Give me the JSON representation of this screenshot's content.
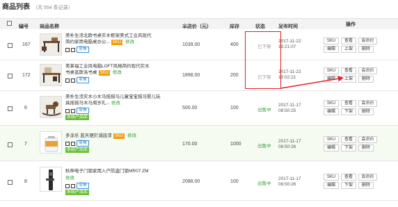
{
  "page": {
    "title": "商品列表",
    "count_text": "（共 554 条记录）"
  },
  "columns": {
    "no": "编号",
    "name": "商品名称",
    "price": "本店价（元）",
    "stock": "库存",
    "status": "状态",
    "time": "发布时间",
    "ops": "操作",
    "sort_mark": "▲▼"
  },
  "rows": [
    {
      "id": "167",
      "name_line1": "美朴生活北欧书桌实木框架美式工业风现代",
      "name_line2": "简约家用电脑桌办公...",
      "sku_tag": "SKU",
      "edit_label": "修改",
      "category_tag": "零售",
      "price": "1039.00",
      "stock": "400",
      "status": "已下架",
      "date": "2017-11-22",
      "time": "15:21:07",
      "buttons": [
        "SKU",
        "查看",
        "会员价",
        "编辑",
        "上架",
        "删除"
      ]
    },
    {
      "id": "172",
      "name_line1": "美莱福工业风电脑LOFT风格简约现代实木",
      "name_line2": "书桌蓝斯洛书桌",
      "sku_tag": "SKU",
      "edit_label": "修改",
      "category_tag": "零售",
      "price": "1898.00",
      "stock": "200",
      "status": "已下架",
      "date": "2017-11-22",
      "time": "15:02:21",
      "buttons": [
        "SKU",
        "查看",
        "会员价",
        "编辑",
        "上架",
        "删除"
      ]
    },
    {
      "id": "6",
      "name_line1": "美朴生活实木小木马摇摇马儿童宝宝摇马婴儿玩",
      "name_line2": "具摇摇马木马周岁礼...",
      "edit_label": "修改",
      "category_tag": "零售",
      "system_tag": "系统产品库",
      "price": "500.00",
      "stock": "100",
      "status": "出售中",
      "date": "2017-11-17",
      "time": "08:50:25",
      "buttons": [
        "SKU",
        "查看",
        "会员价",
        "编辑",
        "下架",
        "删除"
      ]
    },
    {
      "id": "7",
      "name_line1": "多涂乐 蓝天便於減底漆",
      "sku_tag": "SKU",
      "edit_label": "修改",
      "category_tag": "零售",
      "system_tag": "系统产品库",
      "price": "170.00",
      "stock": "1000",
      "status": "出售中",
      "date": "2017-11-17",
      "time": "08:50:26",
      "buttons": [
        "SKU",
        "查看",
        "会员价",
        "编辑",
        "下架",
        "删除"
      ]
    },
    {
      "id": "8",
      "name_line1": "秋神电子门锁家用入户防盗门锁MR07 ZM",
      "edit_label": "修改",
      "category_tag": "零售",
      "system_tag": "系统产品库",
      "price": "2088.00",
      "stock": "100",
      "status": "出售中",
      "date": "2017-11-17",
      "time": "08:50:26",
      "buttons": [
        "SKU",
        "查看",
        "会员价",
        "编辑",
        "下架",
        "删除"
      ]
    }
  ],
  "colors": {
    "accent_green": "#2e9d2e",
    "annotation_red": "#e0202a",
    "sku_orange": "#f39c12",
    "system_tag_green": "#6bbf3a",
    "category_blue": "#3a8fd6"
  }
}
